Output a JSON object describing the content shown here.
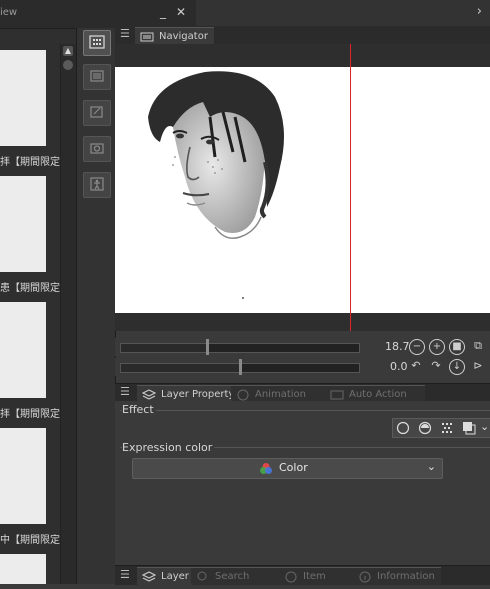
{
  "left_panel": {
    "title": "iew",
    "minimize_label": "_",
    "close_label": "✕",
    "items": [
      {
        "label": "拝【期間限定"
      },
      {
        "label": "患【期間限定"
      },
      {
        "label": "拝【期間限定"
      },
      {
        "label": "中【期間限定"
      }
    ]
  },
  "top_right_chevron": "›",
  "navigator": {
    "tab_label": "Navigator",
    "zoom_value": "18.7",
    "rotate_value": "0.0",
    "zoom_level": 0.36,
    "rotate_level": 0.5
  },
  "layer_property": {
    "tabs": [
      {
        "label": "Layer Property",
        "active": true
      },
      {
        "label": "Animation cels",
        "active": false
      },
      {
        "label": "Auto Action",
        "active": false
      }
    ],
    "effect_label": "Effect",
    "expression_color_label": "Expression color",
    "color_select_value": "Color"
  },
  "layer_panel": {
    "tabs": [
      {
        "label": "Layer",
        "active": true
      },
      {
        "label": "Search Layer",
        "active": false
      },
      {
        "label": "Item bank",
        "active": false
      },
      {
        "label": "Information",
        "active": false
      }
    ]
  },
  "colors": {
    "accent_line": "#e0242a",
    "panel_bg": "#3a3a3a"
  }
}
